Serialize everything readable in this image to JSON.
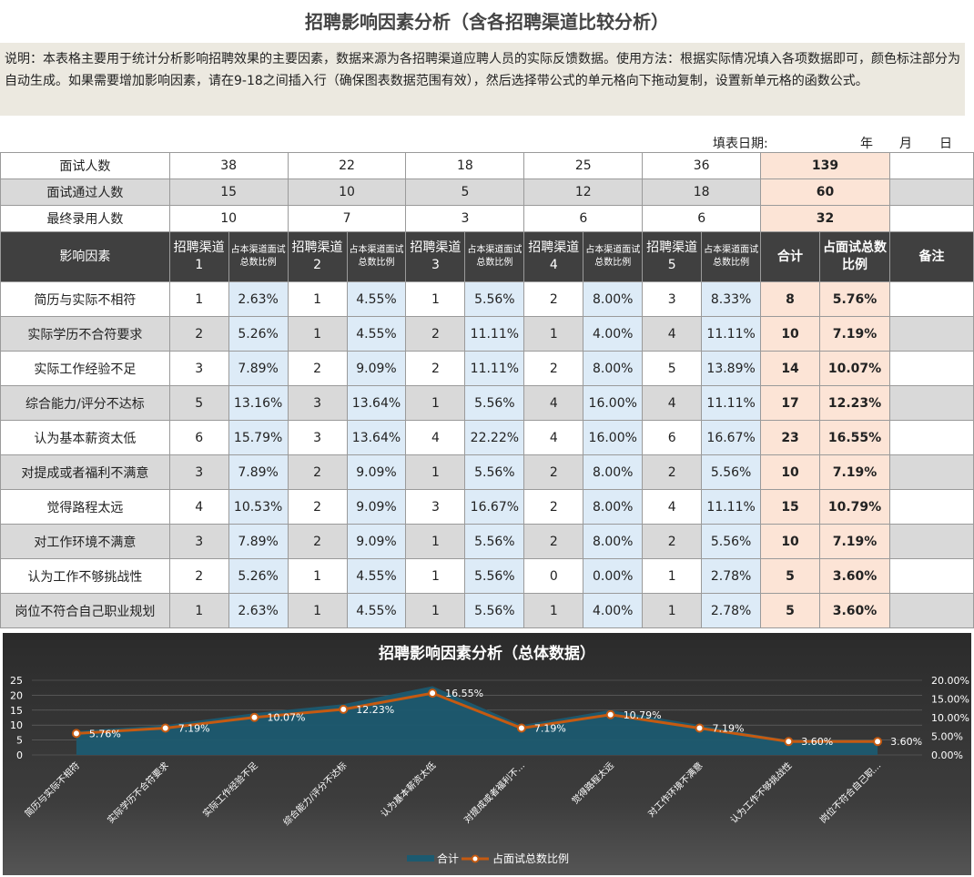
{
  "title": "招聘影响因素分析（含各招聘渠道比较分析）",
  "description": "说明：本表格主要用于统计分析影响招聘效果的主要因素，数据来源为各招聘渠道应聘人员的实际反馈数据。使用方法：根据实际情况填入各项数据即可，颜色标注部分为自动生成。如果需要增加影响因素，请在9-18之间插入行（确保图表数据范围有效），然后选择带公式的单元格向下拖动复制，设置新单元格的函数公式。",
  "date_label": "填表日期:",
  "date_year": "年",
  "date_month": "月",
  "date_day": "日",
  "summary": [
    {
      "label": "面试人数",
      "values": [
        "38",
        "22",
        "18",
        "25",
        "36"
      ],
      "total": "139"
    },
    {
      "label": "面试通过人数",
      "values": [
        "15",
        "10",
        "5",
        "12",
        "18"
      ],
      "total": "60"
    },
    {
      "label": "最终录用人数",
      "values": [
        "10",
        "7",
        "3",
        "6",
        "6"
      ],
      "total": "32"
    }
  ],
  "header": {
    "factor": "影响因素",
    "channels": [
      "招聘渠道1",
      "招聘渠道2",
      "招聘渠道3",
      "招聘渠道4",
      "招聘渠道5"
    ],
    "ratio": "占本渠道面试总数比例",
    "total": "合计",
    "total_ratio": "占面试总数比例",
    "remark": "备注"
  },
  "rows": [
    {
      "factor": "简历与实际不相符",
      "cells": [
        "1",
        "2.63%",
        "1",
        "4.55%",
        "1",
        "5.56%",
        "2",
        "8.00%",
        "3",
        "8.33%"
      ],
      "total": "8",
      "ratio": "5.76%"
    },
    {
      "factor": "实际学历不合符要求",
      "cells": [
        "2",
        "5.26%",
        "1",
        "4.55%",
        "2",
        "11.11%",
        "1",
        "4.00%",
        "4",
        "11.11%"
      ],
      "total": "10",
      "ratio": "7.19%"
    },
    {
      "factor": "实际工作经验不足",
      "cells": [
        "3",
        "7.89%",
        "2",
        "9.09%",
        "2",
        "11.11%",
        "2",
        "8.00%",
        "5",
        "13.89%"
      ],
      "total": "14",
      "ratio": "10.07%"
    },
    {
      "factor": "综合能力/评分不达标",
      "cells": [
        "5",
        "13.16%",
        "3",
        "13.64%",
        "1",
        "5.56%",
        "4",
        "16.00%",
        "4",
        "11.11%"
      ],
      "total": "17",
      "ratio": "12.23%"
    },
    {
      "factor": "认为基本薪资太低",
      "cells": [
        "6",
        "15.79%",
        "3",
        "13.64%",
        "4",
        "22.22%",
        "4",
        "16.00%",
        "6",
        "16.67%"
      ],
      "total": "23",
      "ratio": "16.55%"
    },
    {
      "factor": "对提成或者福利不满意",
      "cells": [
        "3",
        "7.89%",
        "2",
        "9.09%",
        "1",
        "5.56%",
        "2",
        "8.00%",
        "2",
        "5.56%"
      ],
      "total": "10",
      "ratio": "7.19%"
    },
    {
      "factor": "觉得路程太远",
      "cells": [
        "4",
        "10.53%",
        "2",
        "9.09%",
        "3",
        "16.67%",
        "2",
        "8.00%",
        "4",
        "11.11%"
      ],
      "total": "15",
      "ratio": "10.79%"
    },
    {
      "factor": "对工作环境不满意",
      "cells": [
        "3",
        "7.89%",
        "2",
        "9.09%",
        "1",
        "5.56%",
        "2",
        "8.00%",
        "2",
        "5.56%"
      ],
      "total": "10",
      "ratio": "7.19%"
    },
    {
      "factor": "认为工作不够挑战性",
      "cells": [
        "2",
        "5.26%",
        "1",
        "4.55%",
        "1",
        "5.56%",
        "0",
        "0.00%",
        "1",
        "2.78%"
      ],
      "total": "5",
      "ratio": "3.60%"
    },
    {
      "factor": "岗位不符合自己职业规划",
      "cells": [
        "1",
        "2.63%",
        "1",
        "4.55%",
        "1",
        "5.56%",
        "1",
        "4.00%",
        "1",
        "2.78%"
      ],
      "total": "5",
      "ratio": "3.60%"
    }
  ],
  "chart_data": {
    "type": "area",
    "title": "招聘影响因素分析（总体数据）",
    "categories": [
      "简历与实际不相符",
      "实际学历不合符要求",
      "实际工作经验不足",
      "综合能力/评分不达标",
      "认为基本薪资太低",
      "对提成或者福利不...",
      "觉得路程太远",
      "对工作环境不满意",
      "认为工作不够挑战性",
      "岗位不符合自己职..."
    ],
    "series": [
      {
        "name": "合计",
        "type": "area",
        "axis": "left",
        "values": [
          8,
          10,
          14,
          17,
          23,
          10,
          15,
          10,
          5,
          5
        ]
      },
      {
        "name": "占面试总数比例",
        "type": "line",
        "axis": "right",
        "values": [
          5.76,
          7.19,
          10.07,
          12.23,
          16.55,
          7.19,
          10.79,
          7.19,
          3.6,
          3.6
        ],
        "labels": [
          "5.76%",
          "7.19%",
          "10.07%",
          "12.23%",
          "16.55%",
          "7.19%",
          "10.79%",
          "7.19%",
          "3.60%",
          "3.60%"
        ]
      }
    ],
    "y_left": {
      "min": 0,
      "max": 25,
      "ticks": [
        "0",
        "5",
        "10",
        "15",
        "20",
        "25"
      ]
    },
    "y_right": {
      "min": 0,
      "max": 20,
      "ticks": [
        "0.00%",
        "5.00%",
        "10.00%",
        "15.00%",
        "20.00%"
      ]
    },
    "legend": "bottom",
    "colors": {
      "area": "#1c5a70",
      "line": "#c55a11",
      "marker_fill": "#ffffff",
      "background": "#3a3a3a"
    }
  }
}
